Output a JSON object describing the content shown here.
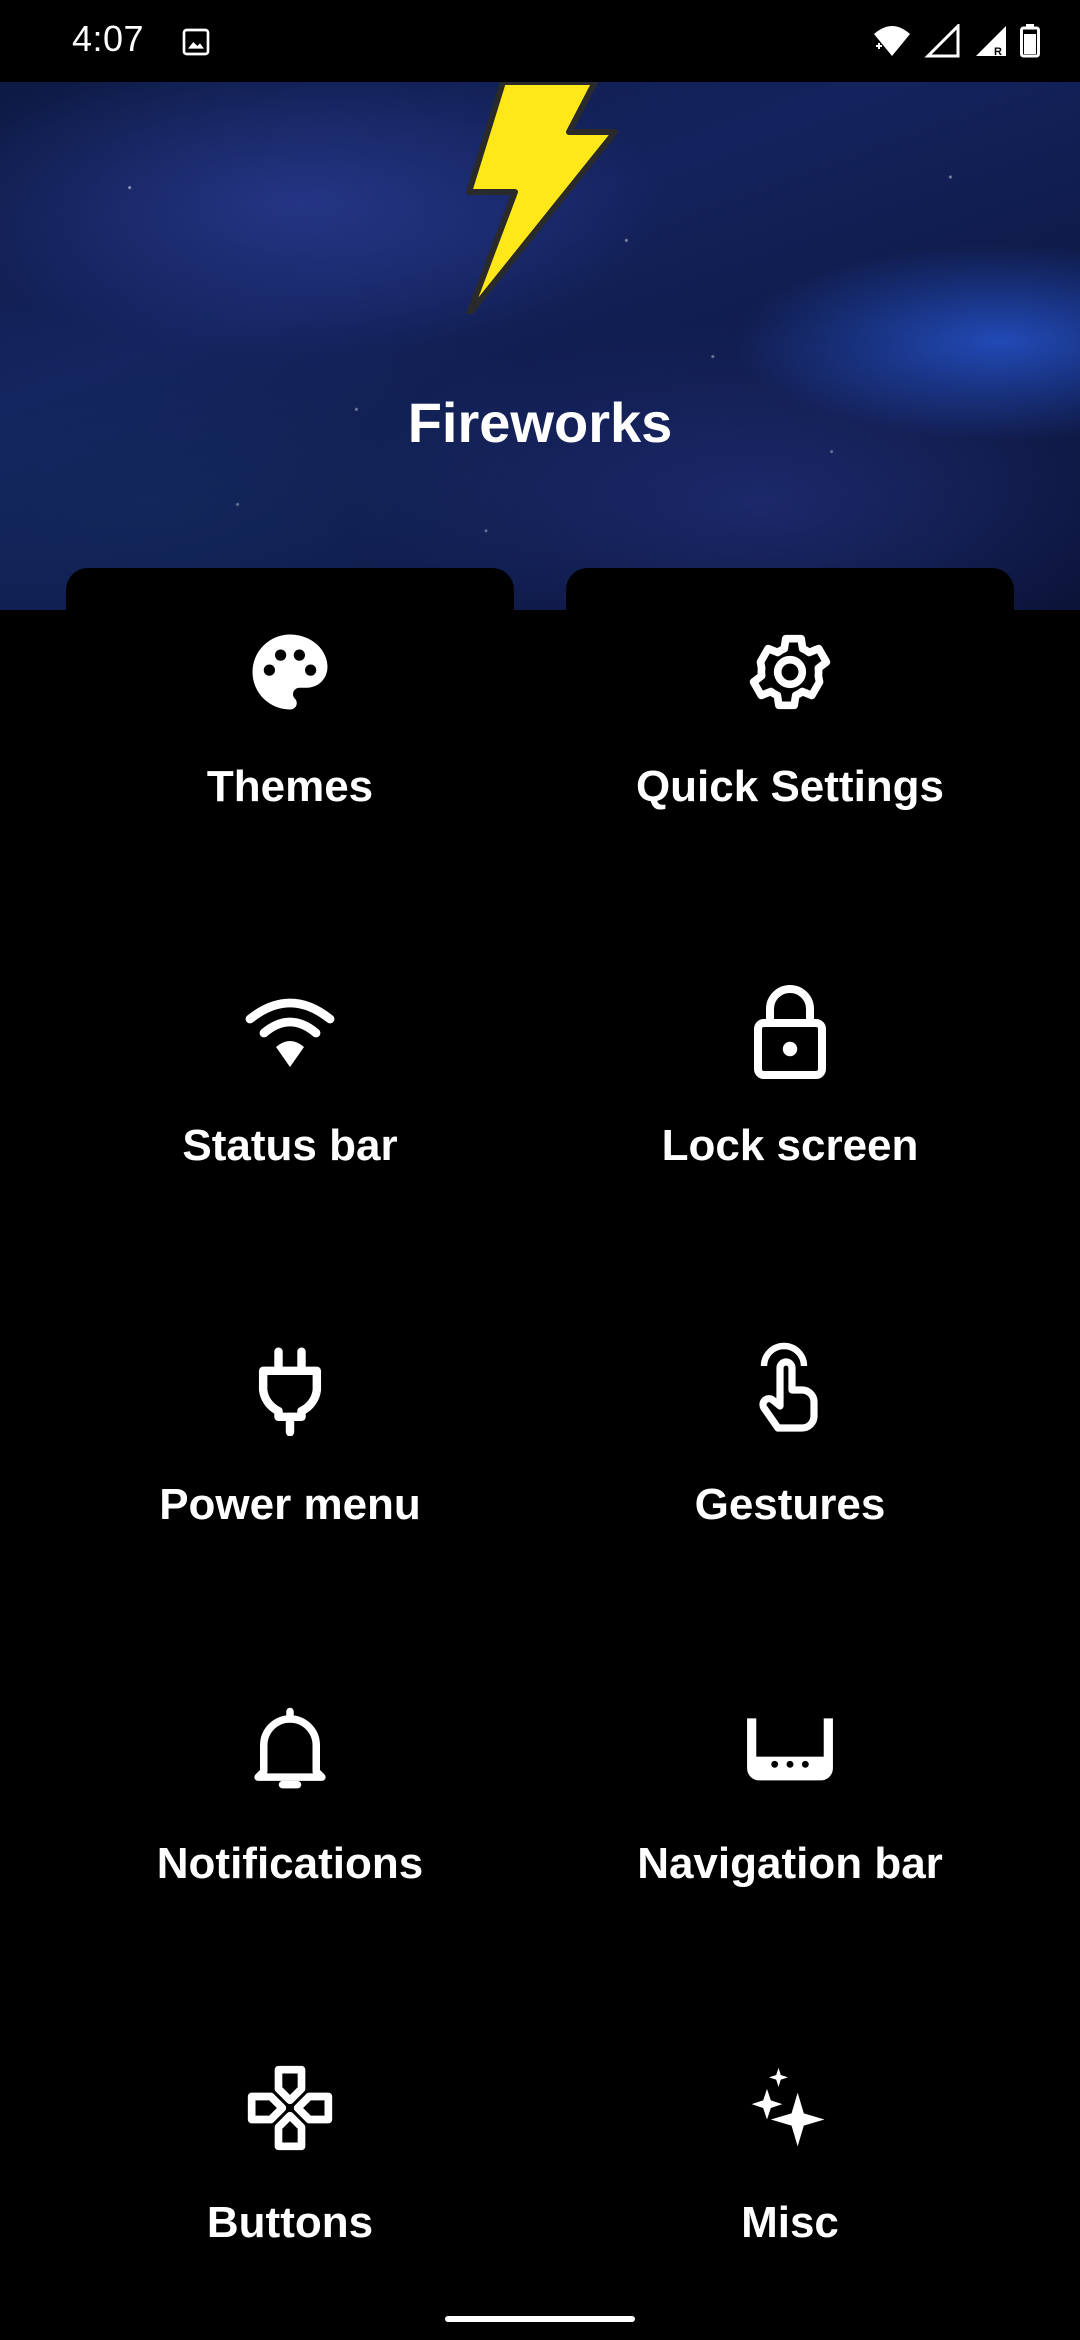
{
  "status_bar": {
    "time": "4:07",
    "left_icon": "image-notification-icon",
    "right_icons": [
      "wifi-icon",
      "signal-icon",
      "signal-roaming-icon",
      "battery-icon"
    ]
  },
  "header": {
    "title": "Fireworks",
    "logo_icon": "lightning-bolt-icon",
    "accent_color": "#FFE81A"
  },
  "menu": {
    "items": [
      {
        "label": "Themes",
        "icon": "palette-icon"
      },
      {
        "label": "Quick Settings",
        "icon": "gear-icon"
      },
      {
        "label": "Status bar",
        "icon": "wifi-icon"
      },
      {
        "label": "Lock screen",
        "icon": "lock-icon"
      },
      {
        "label": "Power menu",
        "icon": "power-plug-icon"
      },
      {
        "label": "Gestures",
        "icon": "touch-gesture-icon"
      },
      {
        "label": "Notifications",
        "icon": "bell-icon"
      },
      {
        "label": "Navigation bar",
        "icon": "navigation-bar-icon"
      },
      {
        "label": "Buttons",
        "icon": "gamepad-icon"
      },
      {
        "label": "Misc",
        "icon": "sparkles-icon"
      }
    ]
  }
}
